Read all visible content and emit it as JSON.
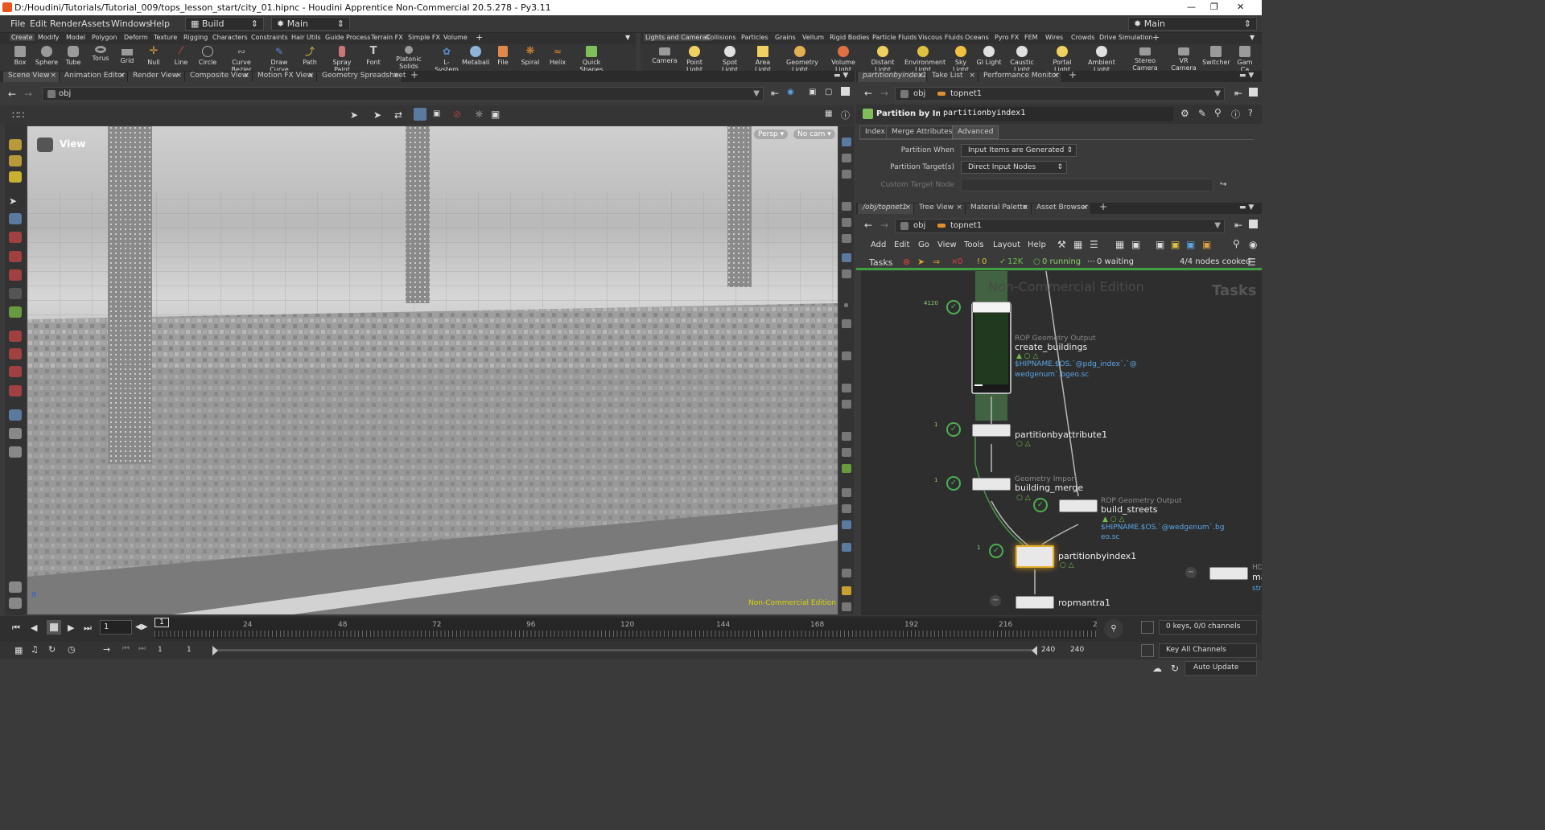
{
  "title": "D:/Houdini/Tutorials/Tutorial_009/tops_lesson_start/city_01.hipnc - Houdini Apprentice Non-Commercial 20.5.278 - Py3.11",
  "menu": {
    "items": [
      "File",
      "Edit",
      "Render",
      "Assets",
      "Windows",
      "Help"
    ],
    "desktop_label": "Build",
    "network_label": "Main",
    "right_desktop_label": "Main"
  },
  "shelf_tabs_left": [
    "Create",
    "Modify",
    "Model",
    "Polygon",
    "Deform",
    "Texture",
    "Rigging",
    "Characters",
    "Constraints",
    "Hair Utils",
    "Guide Process",
    "Terrain FX",
    "Simple FX",
    "Volume"
  ],
  "shelf_tabs_right": [
    "Lights and Cameras",
    "Collisions",
    "Particles",
    "Grains",
    "Vellum",
    "Rigid Bodies",
    "Particle Fluids",
    "Viscous Fluids",
    "Oceans",
    "Pyro FX",
    "FEM",
    "Wires",
    "Crowds",
    "Drive Simulation"
  ],
  "shelf_tools_left": [
    "Box",
    "Sphere",
    "Tube",
    "Torus",
    "Grid",
    "Null",
    "Line",
    "Circle",
    "Curve Bezier",
    "Draw Curve",
    "Path",
    "Spray Paint",
    "Font",
    "Platonic Solids",
    "L-System",
    "Metaball",
    "File",
    "Spiral",
    "Helix",
    "Quick Shapes"
  ],
  "shelf_tools_right": [
    "Camera",
    "Point Light",
    "Spot Light",
    "Area Light",
    "Geometry Light",
    "Volume Light",
    "Distant Light",
    "Environment Light",
    "Sky Light",
    "GI Light",
    "Caustic Light",
    "Portal Light",
    "Ambient Light",
    "Stereo Camera",
    "VR Camera",
    "Switcher",
    "Gam Ca"
  ],
  "pane_tabs_left": [
    "Scene View",
    "Animation Editor",
    "Render View",
    "Composite View",
    "Motion FX View",
    "Geometry Spreadsheet"
  ],
  "left_path": "obj",
  "viewport": {
    "label": "View",
    "persp": "Persp ▾",
    "cam": "No cam ▾",
    "watermark": "Non-Commercial Edition"
  },
  "param_tabs": [
    "partitionbyindex1",
    "Take List",
    "Performance Monitor"
  ],
  "param_path": [
    "obj",
    "topnet1"
  ],
  "param": {
    "node_type": "Partition by Index",
    "node_name": "partitionbyindex1",
    "tabs": [
      "Index",
      "Merge Attributes",
      "Advanced"
    ],
    "rows": [
      {
        "label": "Partition When",
        "value": "Input Items are Generated"
      },
      {
        "label": "Partition Target(s)",
        "value": "Direct Input Nodes"
      },
      {
        "label": "Custom Target Node",
        "value": ""
      }
    ]
  },
  "net_tabs": [
    "/obj/topnet1",
    "Tree View",
    "Material Palette",
    "Asset Browser"
  ],
  "net_path": [
    "obj",
    "topnet1"
  ],
  "net_menu": [
    "Add",
    "Edit",
    "Go",
    "View",
    "Tools",
    "Layout",
    "Help"
  ],
  "tasks_bar": {
    "label": "Tasks",
    "errors": "0",
    "warnings": "0",
    "done": "12K",
    "running": "0 running",
    "waiting": "0 waiting",
    "cooked": "4/4 nodes cooked"
  },
  "net": {
    "watermark": "Non-Commercial Edition",
    "context": "Tasks",
    "nodes": [
      {
        "name": "create_buildings",
        "type": "ROP Geometry Output",
        "expr1": "$HIPNAME.$OS.`@pdg_index`.`@",
        "expr2": "wedgenum`.bgeo.sc",
        "count": "4120"
      },
      {
        "name": "partitionbyattribute1",
        "type": "",
        "count": "1"
      },
      {
        "name": "building_merge",
        "type": "Geometry Import",
        "count": "1"
      },
      {
        "name": "build_streets",
        "type": "ROP Geometry Output",
        "expr1": "$HIPNAME.$OS.`@wedgenum`.bg",
        "expr2": "eo.sc"
      },
      {
        "name": "partitionbyindex1",
        "type": "",
        "count": "1"
      },
      {
        "name": "ropmantra1",
        "type": ""
      },
      {
        "name": "ma",
        "type": "HD",
        "expr1": "str"
      }
    ]
  },
  "timeline": {
    "current_frame": "1",
    "ticks": [
      "1",
      "24",
      "48",
      "72",
      "96",
      "120",
      "144",
      "168",
      "192",
      "216",
      "2"
    ],
    "start": "1",
    "start2": "1",
    "end": "240",
    "end2": "240",
    "keys_info": "0 keys, 0/0 channels",
    "key_all": "Key All Channels",
    "auto_update": "Auto Update"
  }
}
